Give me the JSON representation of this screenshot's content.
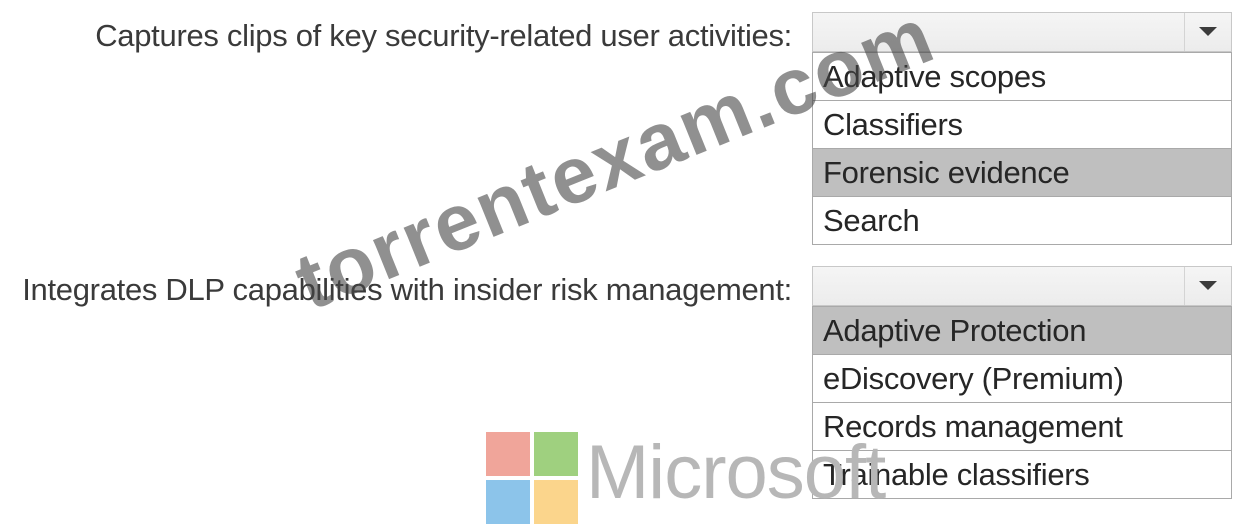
{
  "questions": [
    {
      "label": "Captures clips of key security-related user activities:",
      "selected_value": "",
      "options": [
        "Adaptive scopes",
        "Classifiers",
        "Forensic evidence",
        "Search"
      ],
      "highlighted": "Forensic evidence"
    },
    {
      "label": "Integrates DLP capabilities with insider risk management:",
      "selected_value": "",
      "options": [
        "Adaptive Protection",
        "eDiscovery (Premium)",
        "Records management",
        "Trainable classifiers"
      ],
      "highlighted": "Adaptive Protection"
    }
  ],
  "logo": {
    "text": "Microsoft",
    "colors": {
      "red": "#f0a59a",
      "green": "#9fd07f",
      "blue": "#8cc4ea",
      "yellow": "#fbd58c"
    }
  },
  "watermark": {
    "text": "torrentexam.com"
  }
}
